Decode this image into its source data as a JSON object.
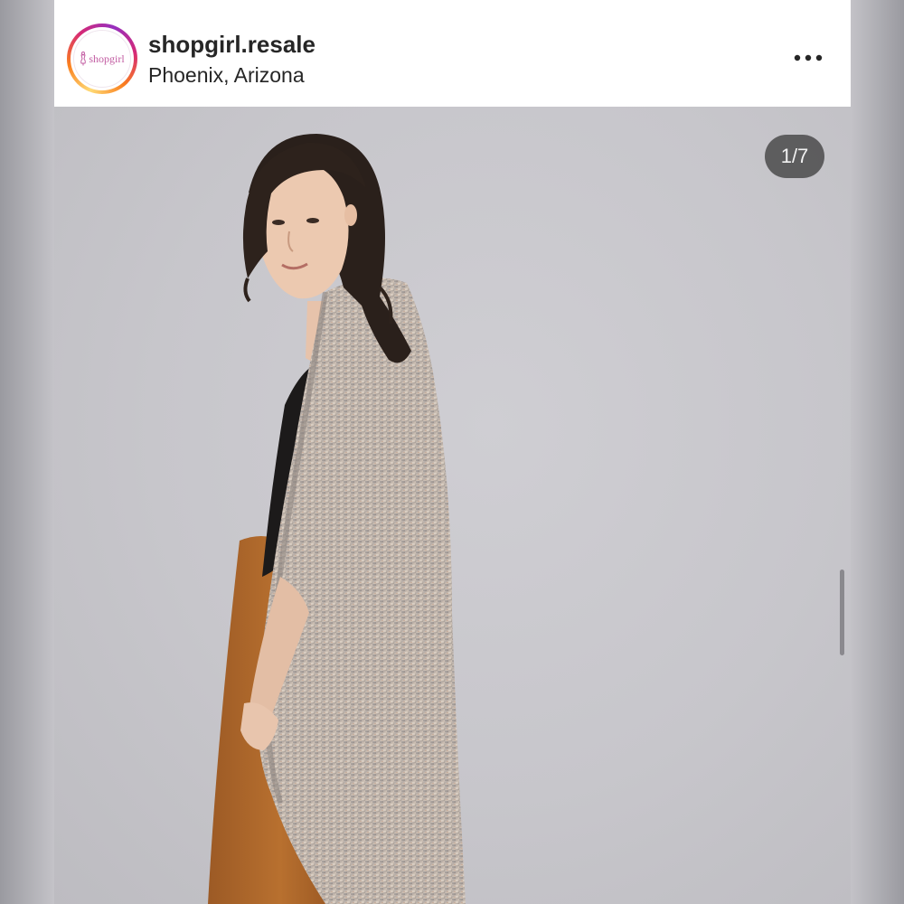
{
  "post": {
    "username": "shopgirl.resale",
    "location": "Phoenix, Arizona",
    "avatar_logo_text": "shopgirl",
    "more_icon": "more-horizontal-icon",
    "image_counter": "1/7",
    "image_description_icon": "photo"
  },
  "colors": {
    "story_ring": [
      "#feda75",
      "#fa7e1e",
      "#d62976",
      "#962fbf"
    ],
    "text": "#262626",
    "photo_background": "#c9c8cd",
    "counter_background": "#343434"
  }
}
